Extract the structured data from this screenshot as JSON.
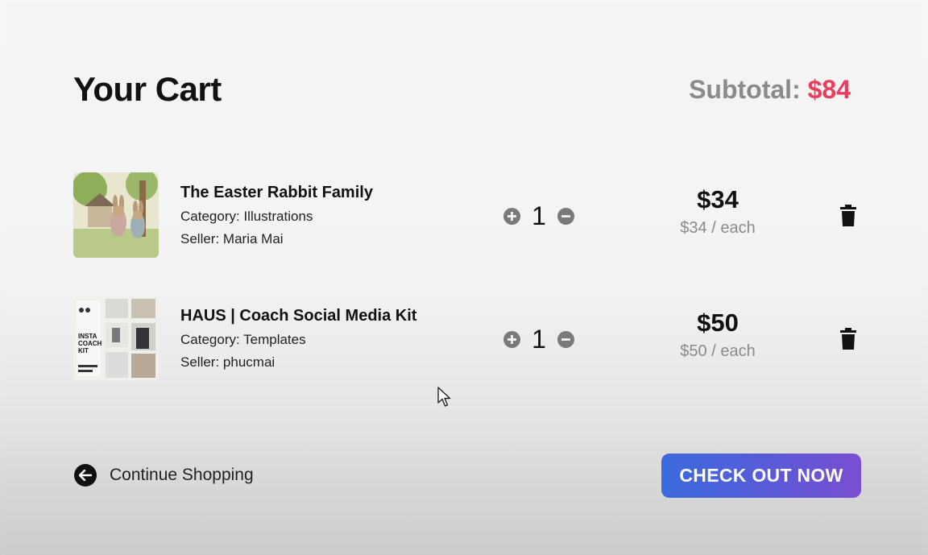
{
  "header": {
    "title": "Your Cart",
    "subtotal_label": "Subtotal:",
    "subtotal_amount": "$84"
  },
  "colors": {
    "accent": "#e83e5e",
    "checkout_gradient_start": "#3a6bdd",
    "checkout_gradient_end": "#7a4ed0"
  },
  "items": [
    {
      "name": "The Easter Rabbit Family",
      "category_label": "Category:",
      "category": "Illustrations",
      "seller_label": "Seller:",
      "seller": "Maria Mai",
      "quantity": "1",
      "total": "$34",
      "each": "$34 / each",
      "thumbnail_icon": "rabbit-illustration-thumbnail"
    },
    {
      "name": "HAUS | Coach Social Media Kit",
      "category_label": "Category:",
      "category": "Templates",
      "seller_label": "Seller:",
      "seller": "phucmai",
      "quantity": "1",
      "total": "$50",
      "each": "$50 / each",
      "thumbnail_icon": "social-media-kit-thumbnail",
      "thumbnail_text": "INSTA COACH KIT"
    }
  ],
  "footer": {
    "continue_label": "Continue Shopping",
    "checkout_label": "CHECK OUT NOW"
  }
}
